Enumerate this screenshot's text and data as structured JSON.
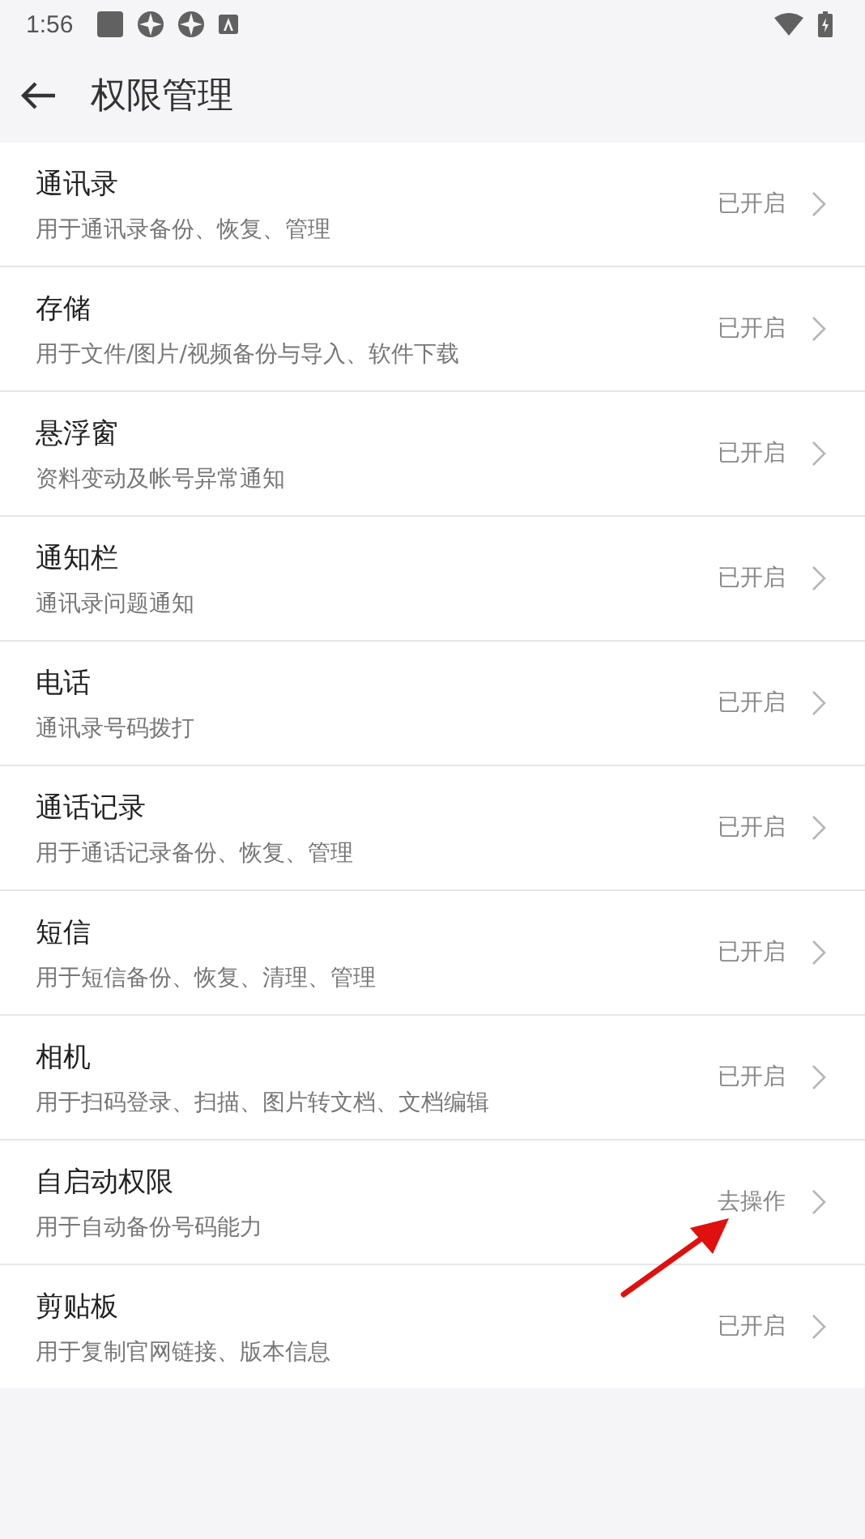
{
  "status_bar": {
    "time": "1:56"
  },
  "header": {
    "title": "权限管理"
  },
  "permissions": [
    {
      "name": "通讯录",
      "description": "用于通讯录备份、恢复、管理",
      "status": "已开启"
    },
    {
      "name": "存储",
      "description": "用于文件/图片/视频备份与导入、软件下载",
      "status": "已开启"
    },
    {
      "name": "悬浮窗",
      "description": "资料变动及帐号异常通知",
      "status": "已开启"
    },
    {
      "name": "通知栏",
      "description": "通讯录问题通知",
      "status": "已开启"
    },
    {
      "name": "电话",
      "description": "通讯录号码拨打",
      "status": "已开启"
    },
    {
      "name": "通话记录",
      "description": "用于通话记录备份、恢复、管理",
      "status": "已开启"
    },
    {
      "name": "短信",
      "description": "用于短信备份、恢复、清理、管理",
      "status": "已开启"
    },
    {
      "name": "相机",
      "description": "用于扫码登录、扫描、图片转文档、文档编辑",
      "status": "已开启"
    },
    {
      "name": "自启动权限",
      "description": "用于自动备份号码能力",
      "status": "去操作"
    },
    {
      "name": "剪贴板",
      "description": "用于复制官网链接、版本信息",
      "status": "已开启"
    }
  ]
}
